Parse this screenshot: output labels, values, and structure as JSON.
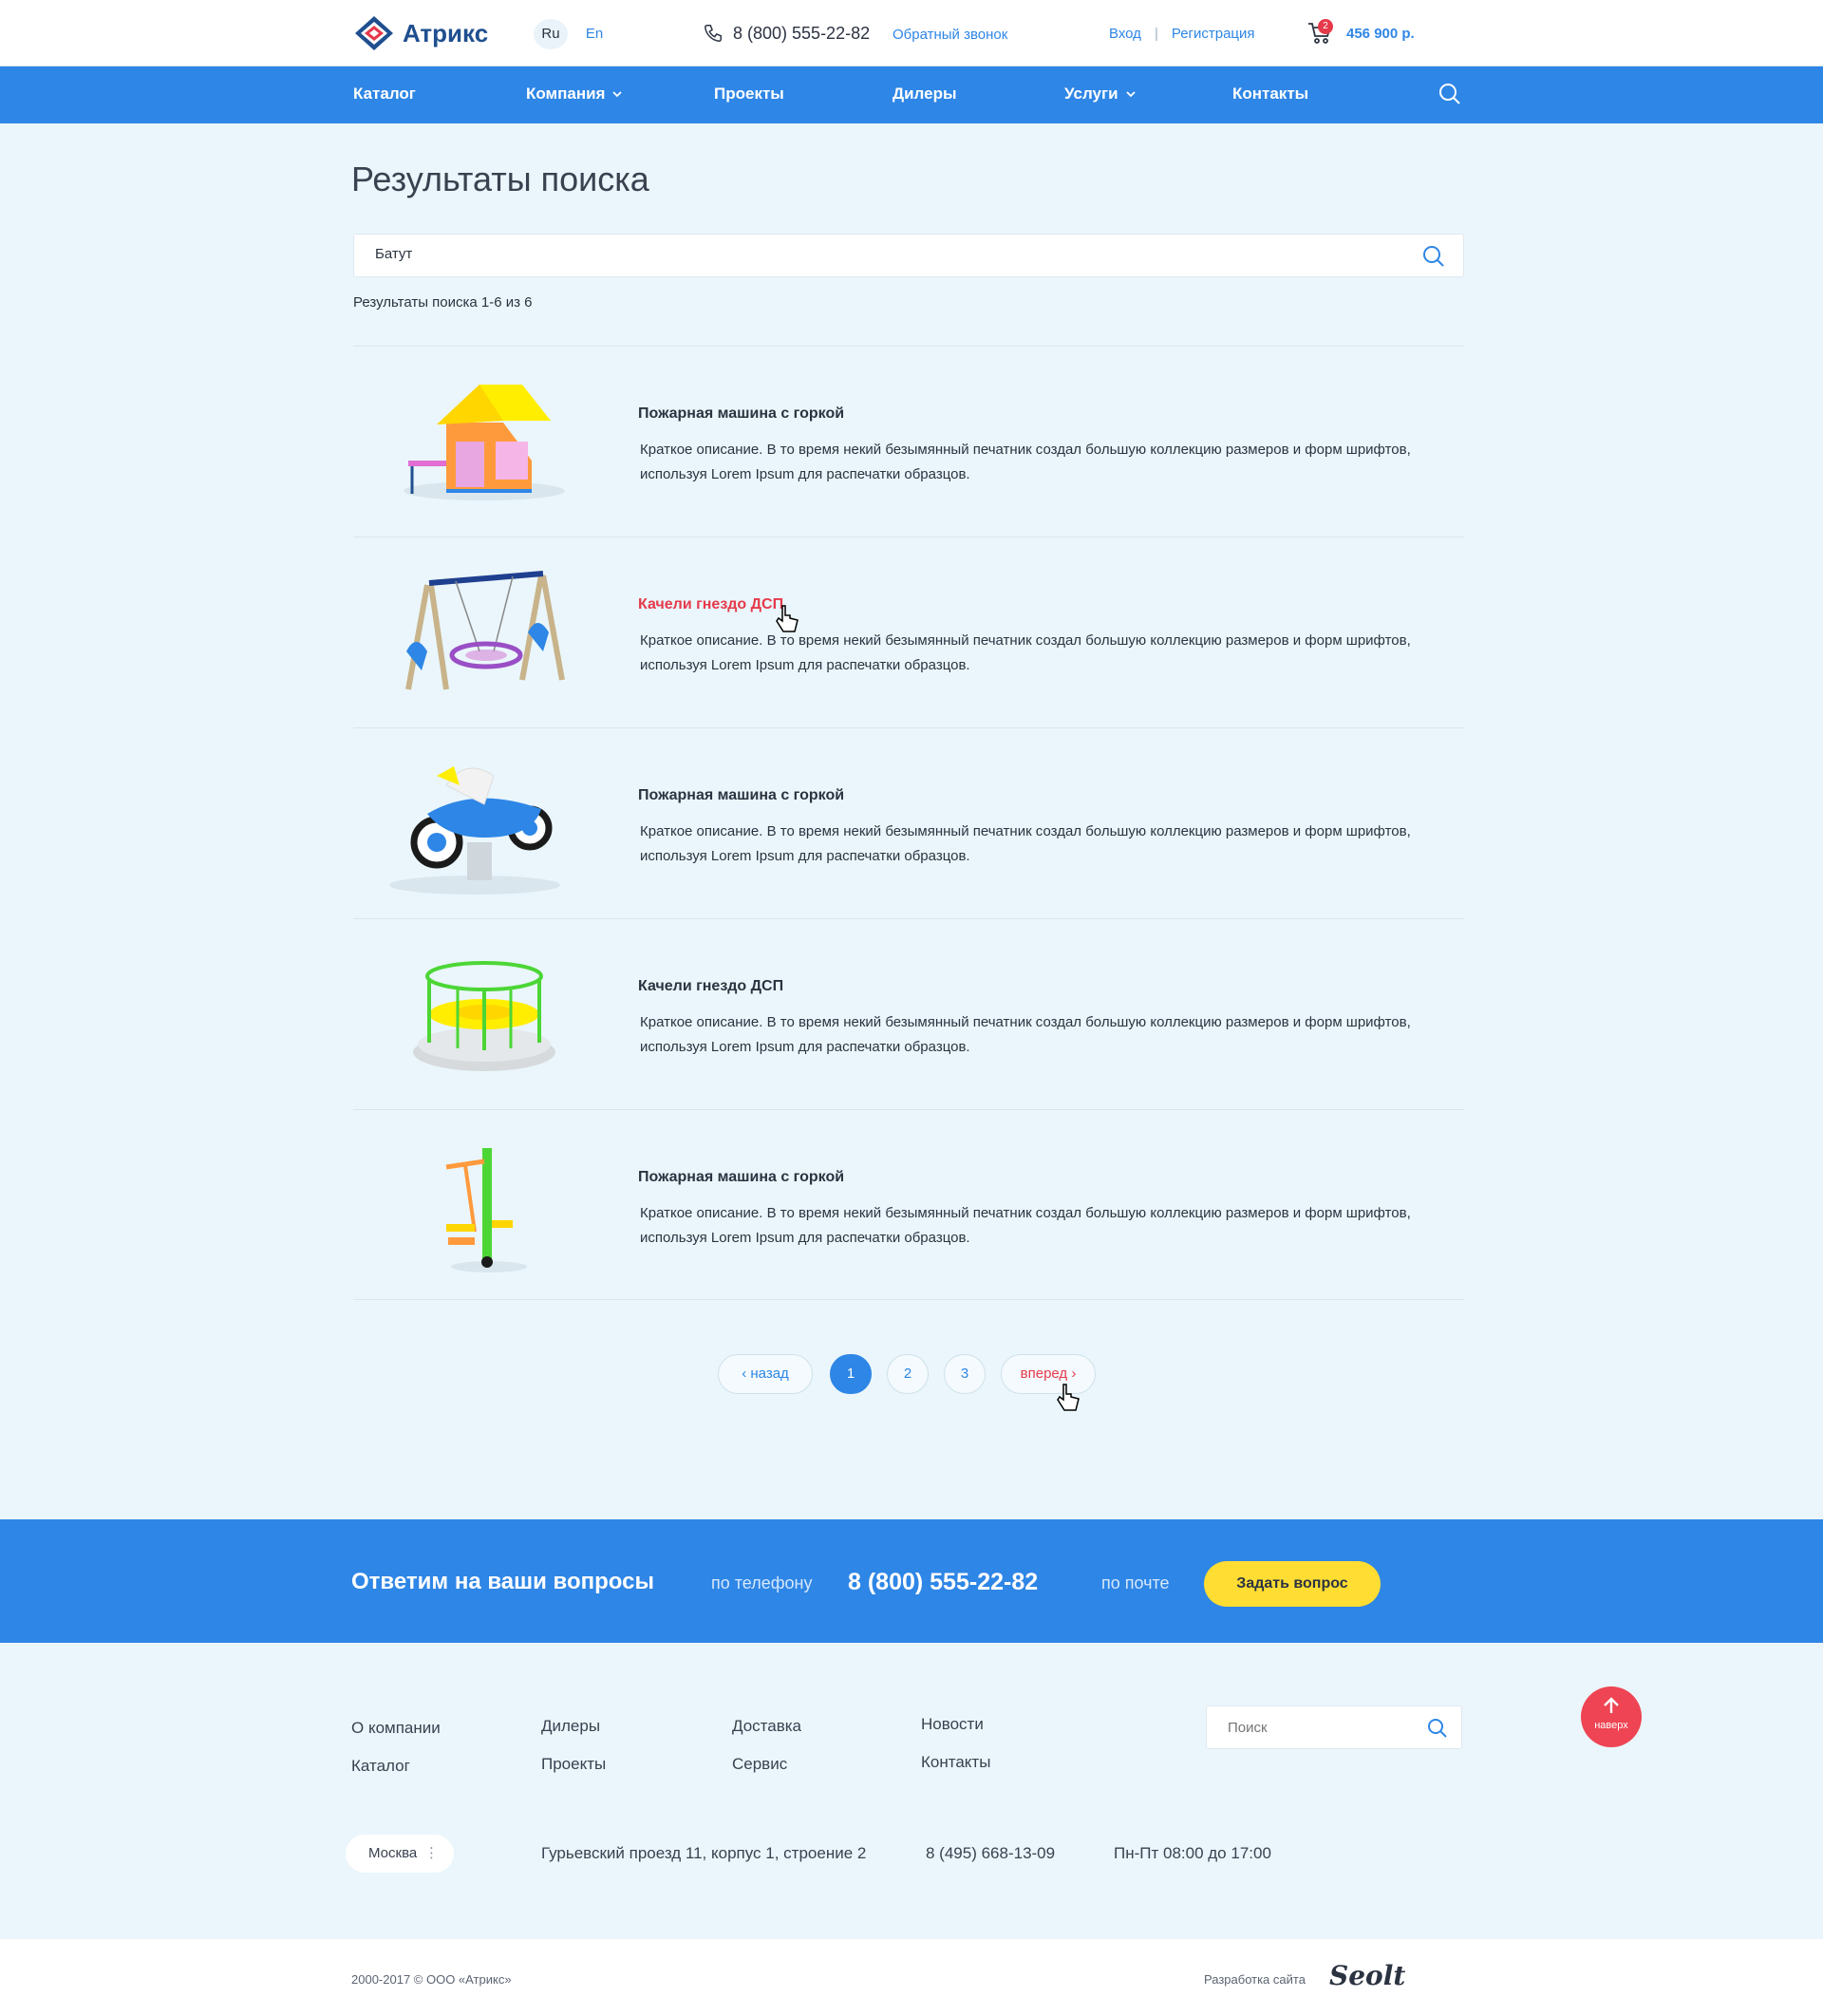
{
  "header": {
    "logo_text": "Атрикс",
    "lang_ru": "Ru",
    "lang_en": "En",
    "phone": "8 (800) 555-22-82",
    "callback": "Обратный звонок",
    "login": "Вход",
    "separator": "|",
    "register": "Регистрация",
    "cart_count": "2",
    "cart_sum": "456 900 р."
  },
  "nav": {
    "items": [
      "Каталог",
      "Компания",
      "Проекты",
      "Дилеры",
      "Услуги",
      "Контакты"
    ]
  },
  "main": {
    "title": "Результаты поиска",
    "search_value": "Батут",
    "results_count": "Результаты поиска 1-6 из 6",
    "results": [
      {
        "title": "Пожарная машина с горкой",
        "desc": "Краткое описание. В то время некий безымянный печатник создал большую коллекцию размеров и форм шрифтов, используя Lorem Ipsum для распечатки образцов."
      },
      {
        "title": "Качели гнездо ДСП",
        "desc": "Краткое описание. В то время некий безымянный печатник создал большую коллекцию размеров и форм шрифтов, используя Lorem Ipsum для распечатки образцов."
      },
      {
        "title": "Пожарная машина с горкой",
        "desc": "Краткое описание. В то время некий безымянный печатник создал большую коллекцию размеров и форм шрифтов, используя Lorem Ipsum для распечатки образцов."
      },
      {
        "title": "Качели гнездо ДСП",
        "desc": "Краткое описание. В то время некий безымянный печатник создал большую коллекцию размеров и форм шрифтов, используя Lorem Ipsum для распечатки образцов."
      },
      {
        "title": "Пожарная машина с горкой",
        "desc": "Краткое описание. В то время некий безымянный печатник создал большую коллекцию размеров и форм шрифтов, используя Lorem Ipsum для распечатки образцов."
      }
    ]
  },
  "pagination": {
    "prev": "‹ назад",
    "pages": [
      "1",
      "2",
      "3"
    ],
    "current": "1",
    "next": "вперед ›"
  },
  "cta": {
    "title": "Ответим на ваши вопросы",
    "by_phone": "по телефону",
    "phone": "8 (800) 555-22-82",
    "by_mail": "по почте",
    "button": "Задать вопрос"
  },
  "footer": {
    "links": [
      "О компании",
      "Каталог",
      "Дилеры",
      "Проекты",
      "Доставка",
      "Сервис",
      "Новости",
      "Контакты"
    ],
    "search_placeholder": "Поиск",
    "to_top": "наверх",
    "city": "Москва",
    "address": "Гурьевский проезд 11, корпус 1, строение 2",
    "phone": "8 (495) 668-13-09",
    "hours": "Пн-Пт 08:00 до 17:00",
    "copyright": "2000-2017 © ООО «Атрикс»",
    "dev_label": "Разработка сайта",
    "dev_logo": "Seolt"
  },
  "colors": {
    "primary": "#2e86e6",
    "accent_red": "#e53a4b",
    "cta_button": "#ffdd33",
    "page_bg": "#eaf6fb"
  },
  "icons": [
    "logo-mark",
    "phone-icon",
    "cart-icon",
    "search-icon",
    "chevron-down-icon",
    "arrow-up-icon",
    "pointer-cursor-icon"
  ]
}
